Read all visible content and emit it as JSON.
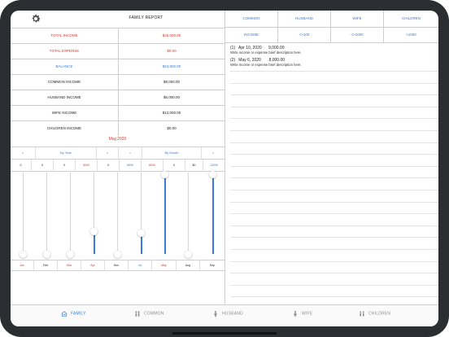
{
  "header": {
    "title": "FAMILY REPORT"
  },
  "summary": [
    {
      "label": "TOTAL INCOME",
      "value": "$25,000.00",
      "color": "#d33a2c"
    },
    {
      "label": "TOTAL EXPENSE",
      "value": "$0.00",
      "color": "#d33a2c"
    },
    {
      "label": "BALANCE",
      "value": "$24,900.00",
      "color": "#3a7bd5"
    },
    {
      "label": "COMMON INCOME",
      "value": "$8,000.00",
      "color": "#222222"
    },
    {
      "label": "HUSBAND INCOME",
      "value": "$5,000.00",
      "color": "#222222"
    },
    {
      "label": "WIFE INCOME",
      "value": "$12,000.00",
      "color": "#222222"
    },
    {
      "label": "CHILDREN INCOME",
      "value": "$0.00",
      "color": "#222222"
    }
  ],
  "month_label": "May,2020",
  "nav": {
    "prev_left": "<",
    "period_left": "By Year",
    "next_left": ">",
    "prev_right": "<",
    "period_right": "By Month",
    "next_right": ">"
  },
  "period_values": [
    "0",
    "0",
    "0",
    "5000",
    "0",
    "5500",
    "8000",
    "0",
    "$0",
    "12000"
  ],
  "month_cells": [
    "Jan",
    "Feb",
    "Mar",
    "Apr",
    "Nov",
    "Jul",
    "May",
    "Aug",
    "Sep"
  ],
  "slider_levels": [
    0,
    0,
    0,
    0.28,
    0,
    0.26,
    0.98,
    0,
    0.98
  ],
  "right_header": [
    "COMMON",
    "HUSBAND",
    "WIFE",
    "CHILDREN"
  ],
  "right_subheader": [
    "INCOME",
    "<>100",
    "<>1000",
    ">1000"
  ],
  "entries": [
    {
      "index": "(1)",
      "date": "Apr 10, 2020",
      "amount": "9,000.00",
      "desc": "Write income or expense brief description here."
    },
    {
      "index": "(2)",
      "date": "May 6, 2020",
      "amount": "8,000.00",
      "desc": "Write income or expense brief description here."
    }
  ],
  "tabs": [
    {
      "label": "FAMILY",
      "icon": "family-icon",
      "active": true
    },
    {
      "label": "COMMON",
      "icon": "common-icon",
      "active": false
    },
    {
      "label": "HUSBAND",
      "icon": "husband-icon",
      "active": false
    },
    {
      "label": "WIFE",
      "icon": "wife-icon",
      "active": false
    },
    {
      "label": "CHILDREN",
      "icon": "children-icon",
      "active": false
    }
  ],
  "colors": {
    "accent": "#3a7bd5",
    "expense": "#d33a2c",
    "tab_inactive": "#8e8e93"
  }
}
